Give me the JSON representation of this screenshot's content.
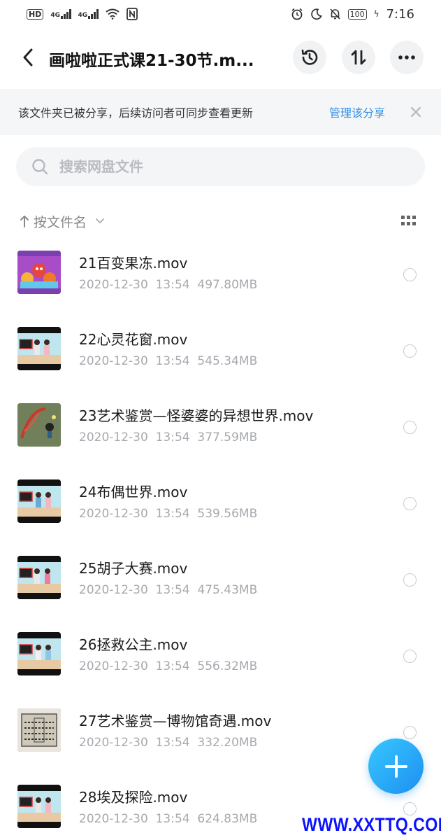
{
  "status_bar": {
    "hd": "HD",
    "net1": "4G",
    "net2": "4G",
    "battery": "100",
    "time": "7:16"
  },
  "header": {
    "title": "画啦啦正式课21-30节.m...",
    "icons": [
      "back-icon",
      "history-icon",
      "sort-order-icon",
      "more-icon"
    ]
  },
  "share_banner": {
    "text": "该文件夹已被分享，后续访问者可同步查看更新",
    "link": "管理该分享",
    "accent": "#2f8fe8"
  },
  "search": {
    "placeholder": "搜索网盘文件"
  },
  "sort": {
    "label": "按文件名"
  },
  "files": [
    {
      "name": "21百变果冻.mov",
      "date": "2020-12-30",
      "time": "13:54",
      "size": "497.80MB",
      "thumb": "cartoon"
    },
    {
      "name": "22心灵花窗.mov",
      "date": "2020-12-30",
      "time": "13:54",
      "size": "545.34MB",
      "thumb": "studio"
    },
    {
      "name": "23艺术鉴赏—怪婆婆的异想世界.mov",
      "date": "2020-12-30",
      "time": "13:54",
      "size": "377.59MB",
      "thumb": "art"
    },
    {
      "name": "24布偶世界.mov",
      "date": "2020-12-30",
      "time": "13:54",
      "size": "539.56MB",
      "thumb": "studio"
    },
    {
      "name": "25胡子大赛.mov",
      "date": "2020-12-30",
      "time": "13:54",
      "size": "475.43MB",
      "thumb": "studio"
    },
    {
      "name": "26拯救公主.mov",
      "date": "2020-12-30",
      "time": "13:54",
      "size": "556.32MB",
      "thumb": "studio"
    },
    {
      "name": "27艺术鉴赏—博物馆奇遇.mov",
      "date": "2020-12-30",
      "time": "13:54",
      "size": "332.20MB",
      "thumb": "museum"
    },
    {
      "name": "28埃及探险.mov",
      "date": "2020-12-30",
      "time": "13:54",
      "size": "624.83MB",
      "thumb": "studio"
    }
  ],
  "fab": {
    "icon": "plus-icon",
    "color": "#1e8ff0"
  },
  "watermark": "WWW.XXTTQ.COM"
}
